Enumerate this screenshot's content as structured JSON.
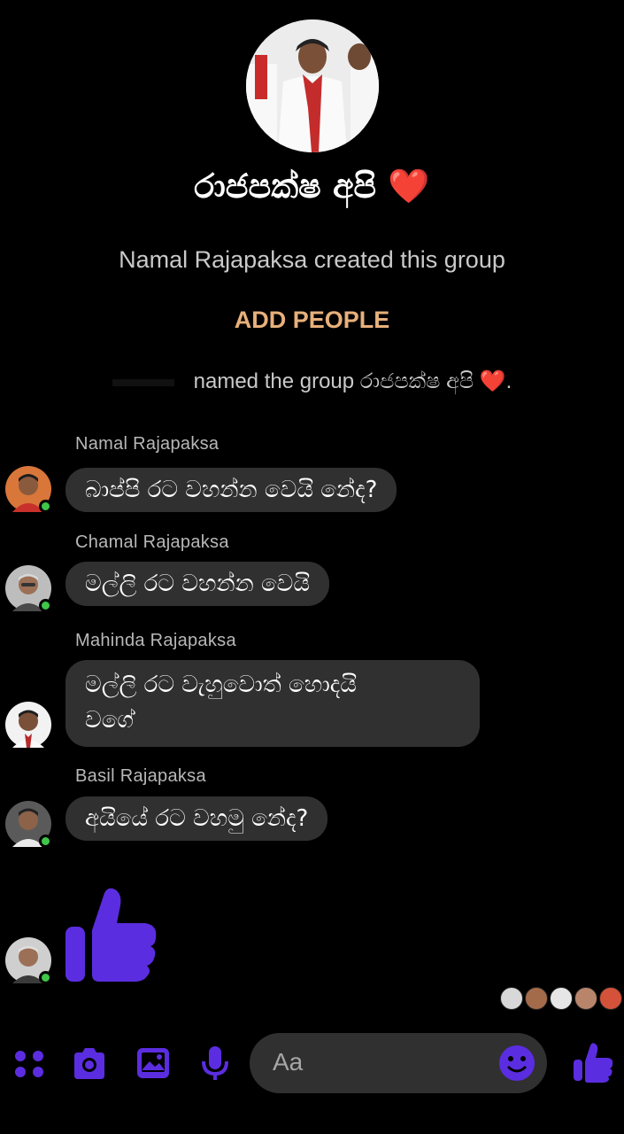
{
  "group": {
    "title": "රාජපක්ෂ අපි",
    "title_emoji": "❤️",
    "created_text": "Namal Rajapaksa created this group",
    "add_people_label": "ADD PEOPLE",
    "rename_text": "named the group රාජපක්ෂ අපි",
    "rename_emoji": "❤️",
    "rename_suffix": "."
  },
  "messages": [
    {
      "sender": "Namal Rajapaksa",
      "text": "බාප්පි රට වහන්න වෙයි නේද?"
    },
    {
      "sender": "Chamal Rajapaksa",
      "text": "මල්ලි රට වහන්න වෙයි"
    },
    {
      "sender": "Mahinda Rajapaksa",
      "line1": "මල්ලි රට වැහුවොත් හොදයි",
      "line2": "වගේ"
    },
    {
      "sender": "Basil Rajapaksa",
      "text": "අයියේ රට වහමු නේද?"
    }
  ],
  "composer": {
    "placeholder": "Aa"
  },
  "colors": {
    "accent": "#5b2de0",
    "bubble": "#303030",
    "add_people": "#e8b07a",
    "online": "#3fc64a"
  },
  "icons": [
    "menu-grid-icon",
    "camera-icon",
    "gallery-icon",
    "microphone-icon",
    "emoji-icon",
    "thumbs-up-icon"
  ]
}
